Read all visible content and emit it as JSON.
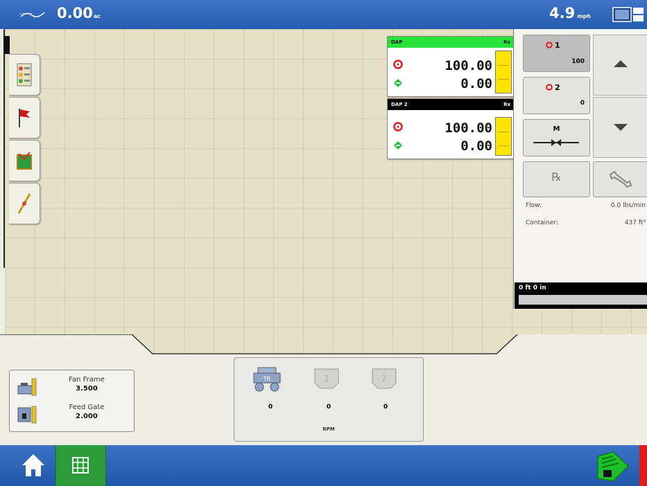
{
  "topbar": {
    "area_value": "0.00",
    "area_unit": "ac",
    "speed_value": "4.9",
    "speed_unit": "mph"
  },
  "products": [
    {
      "name": "DAP",
      "tag": "Rx",
      "header_color": "#27e23b",
      "target_rate": "100.00",
      "actual_rate": "0.00"
    },
    {
      "name": "DAP 2",
      "tag": "Rx",
      "header_color": "#000000",
      "target_rate": "100.00",
      "actual_rate": "0.00"
    }
  ],
  "sections": [
    {
      "label": "1",
      "rate": "100"
    },
    {
      "label": "2",
      "rate": "0"
    }
  ],
  "manual_button": {
    "label": "M"
  },
  "rx_button": {
    "label": "℞"
  },
  "info": {
    "flow_label": "Flow:",
    "flow_value": "0.0 lbs/min",
    "container_label": "Container:",
    "container_value": "437 ft³"
  },
  "depth": {
    "label": "0 ft 0 in"
  },
  "fan_frame": {
    "label": "Fan Frame",
    "value": "3.500"
  },
  "feed_gate": {
    "label": "Feed Gate",
    "value": "2.000"
  },
  "rpm": {
    "values": [
      "0",
      "0",
      "0"
    ],
    "unit": "RPM",
    "fan_labels": [
      "",
      "1",
      "2"
    ]
  },
  "colors": {
    "topbar": "#2a63b6",
    "bottombar": "#2b62b6",
    "grid_button": "#2c9b3a",
    "rate_bar": "#ffe400",
    "map": "#e6e0c6"
  },
  "icons": [
    "acres-icon",
    "display-toggle-icon",
    "checklist-icon",
    "flag-icon",
    "map-layer-icon",
    "guidance-icon",
    "target-rate-icon",
    "actual-rate-icon",
    "wrench-icon",
    "home-icon",
    "grid-icon",
    "field-operation-icon"
  ]
}
